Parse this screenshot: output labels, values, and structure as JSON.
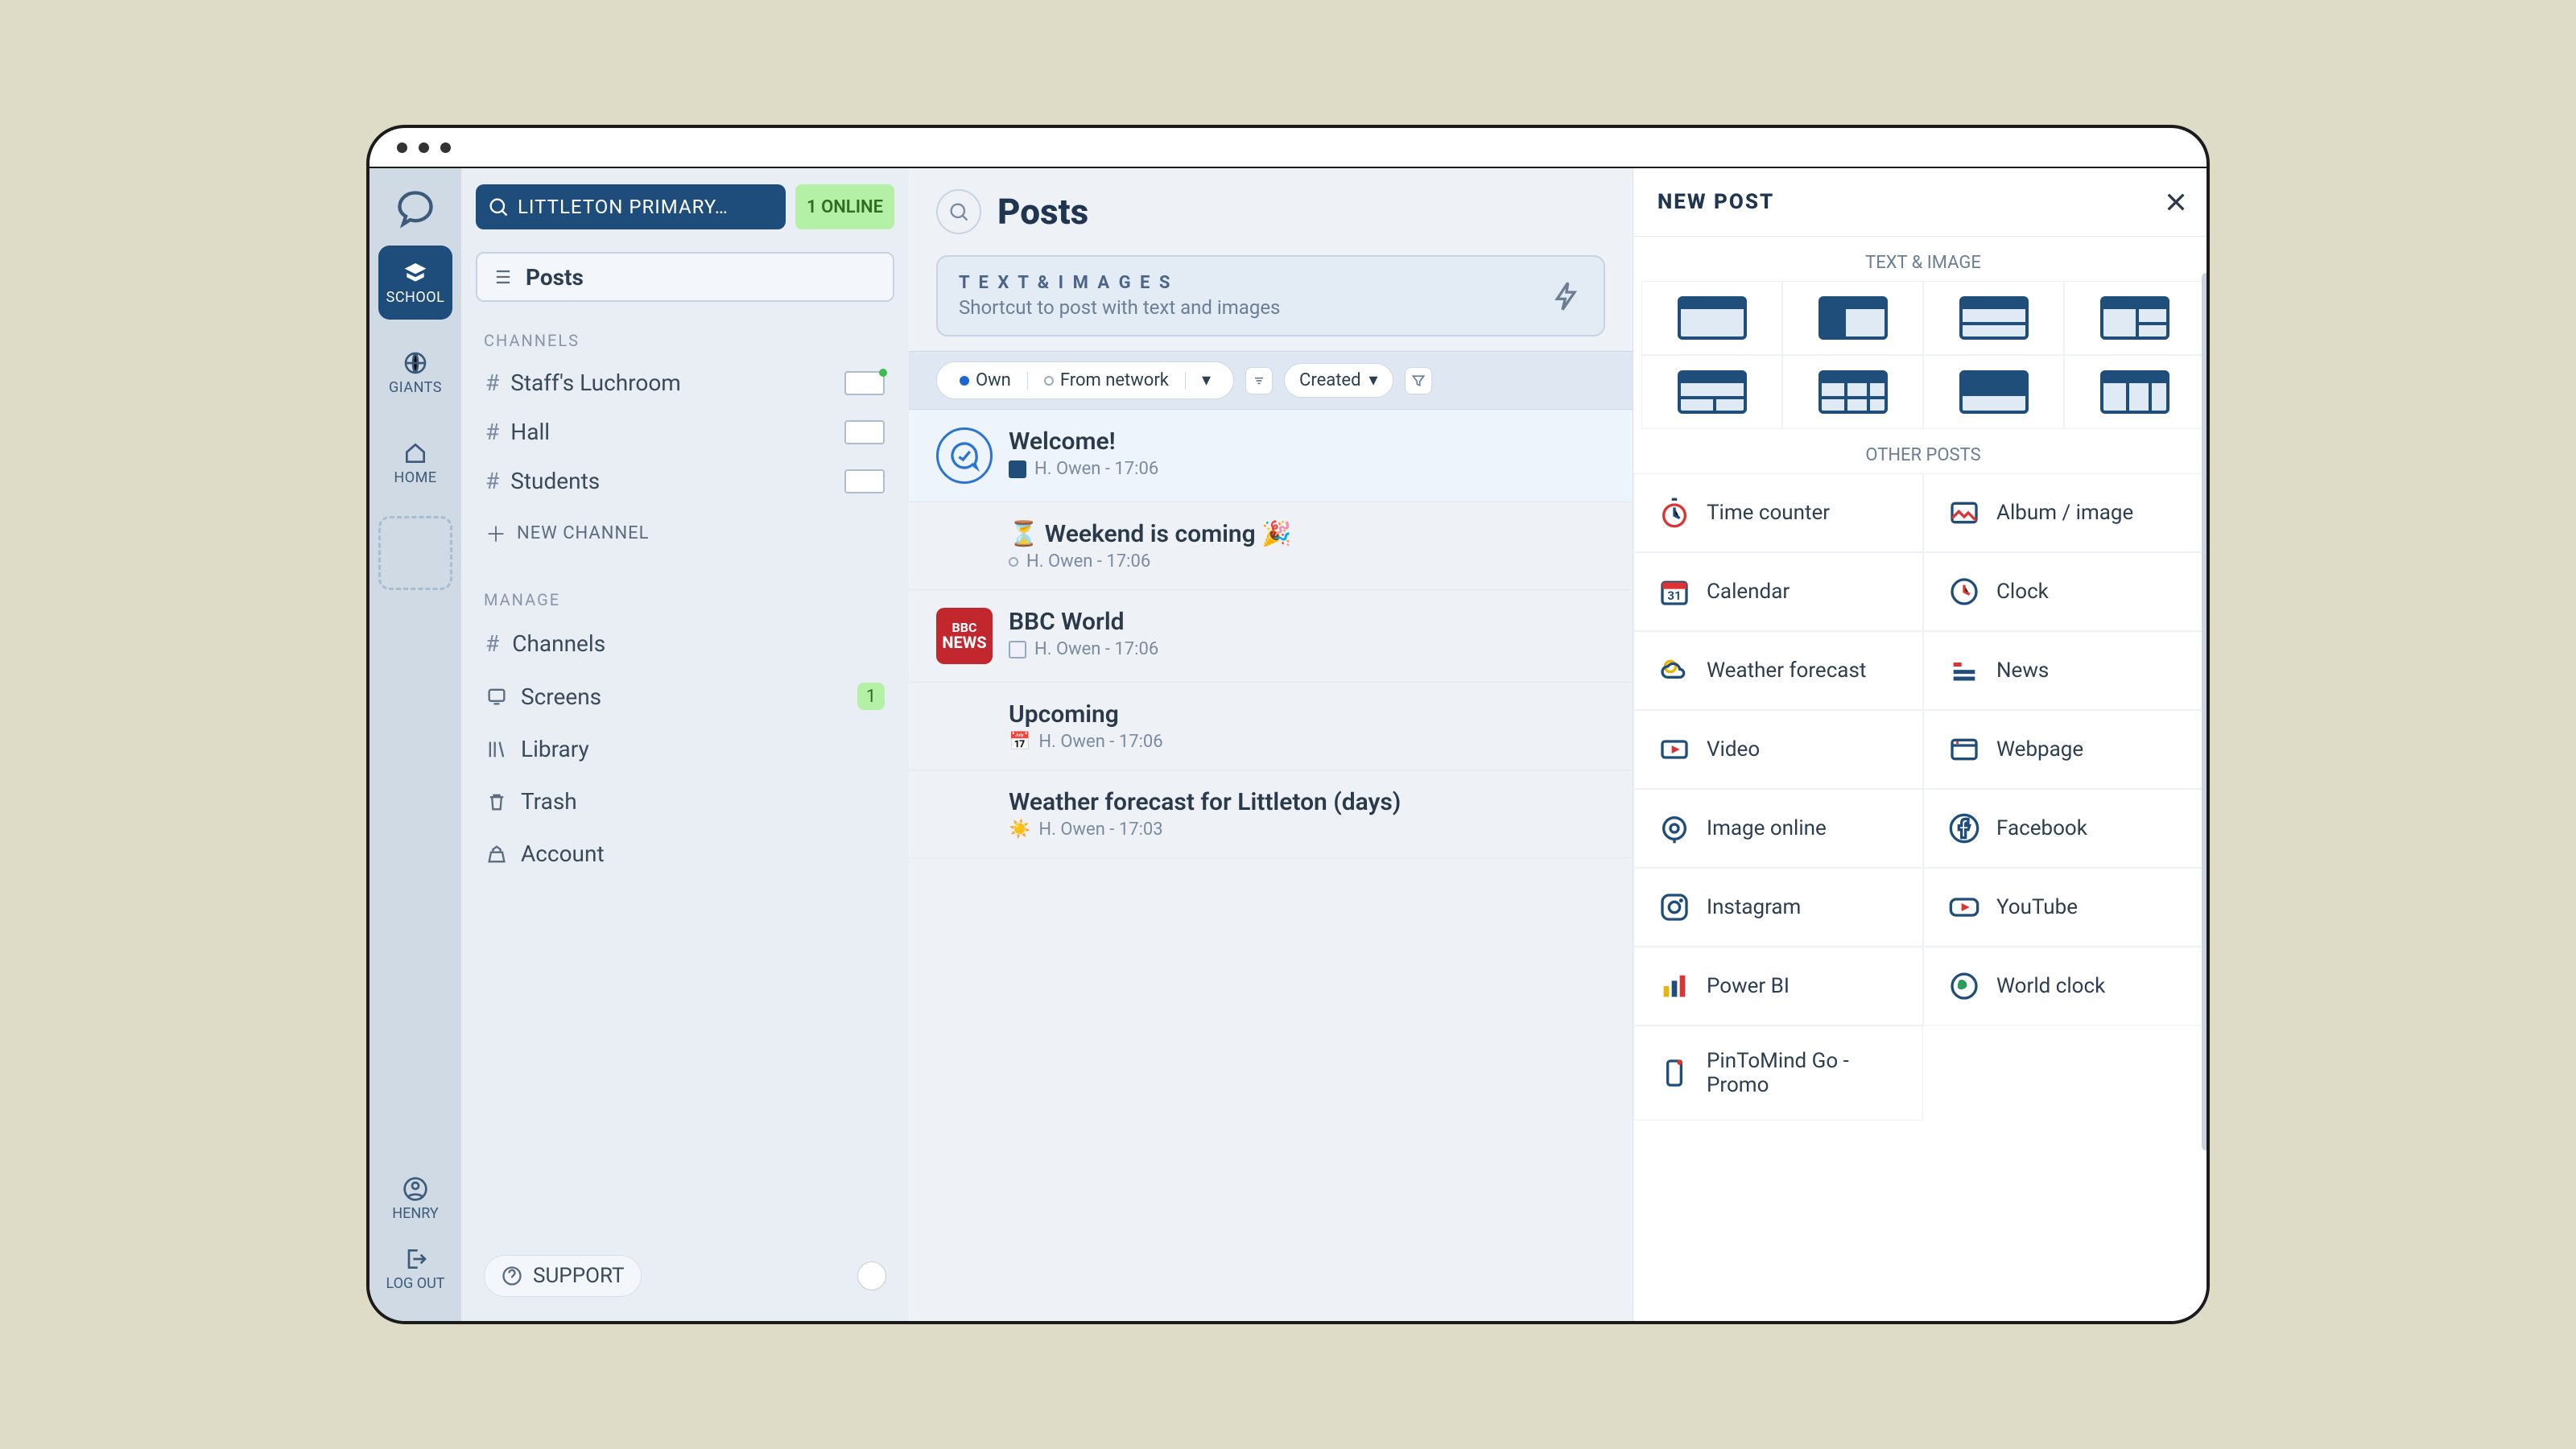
{
  "rail": {
    "items": [
      {
        "label": "SCHOOL",
        "active": true
      },
      {
        "label": "GIANTS",
        "active": false
      },
      {
        "label": "HOME",
        "active": false
      }
    ],
    "user": "HENRY",
    "logout": "LOG OUT"
  },
  "sidebar": {
    "org_name": "LITTLETON PRIMARY…",
    "online_badge": "1  ONLINE",
    "current": "Posts",
    "channels_label": "CHANNELS",
    "channels": [
      {
        "name": "Staff's Luchroom",
        "live": true
      },
      {
        "name": "Hall",
        "live": false
      },
      {
        "name": "Students",
        "live": false
      }
    ],
    "new_channel": "NEW CHANNEL",
    "manage_label": "MANAGE",
    "manage": [
      {
        "name": "Channels",
        "icon": "hash"
      },
      {
        "name": "Screens",
        "icon": "screen",
        "badge": "1"
      },
      {
        "name": "Library",
        "icon": "library"
      },
      {
        "name": "Trash",
        "icon": "trash"
      },
      {
        "name": "Account",
        "icon": "account"
      }
    ],
    "support": "SUPPORT"
  },
  "main": {
    "title": "Posts",
    "shortcut_title": "T E X T   &   I M A G E S",
    "shortcut_sub": "Shortcut to post with text and images",
    "filter_own": "Own",
    "filter_network": "From network",
    "filter_created": "Created",
    "posts": [
      {
        "title": "Welcome!",
        "meta": "H. Owen - 17:06",
        "icon": "chat"
      },
      {
        "title": "⏳ Weekend is coming 🎉",
        "meta": "H. Owen - 17:06",
        "icon": "none"
      },
      {
        "title": "BBC World",
        "meta": "H. Owen - 17:06",
        "icon": "bbc"
      },
      {
        "title": "Upcoming",
        "meta": "H. Owen - 17:06",
        "icon": "cal"
      },
      {
        "title": "Weather forecast for Littleton (days)",
        "meta": "H. Owen - 17:03",
        "icon": "sun"
      }
    ]
  },
  "panel": {
    "title": "NEW POST",
    "text_image_label": "TEXT & IMAGE",
    "other_label": "OTHER POSTS",
    "other": [
      "Time counter",
      "Album / image",
      "Calendar",
      "Clock",
      "Weather forecast",
      "News",
      "Video",
      "Webpage",
      "Image online",
      "Facebook",
      "Instagram",
      "YouTube",
      "Power BI",
      "World clock",
      "PinToMind Go - Promo"
    ]
  }
}
